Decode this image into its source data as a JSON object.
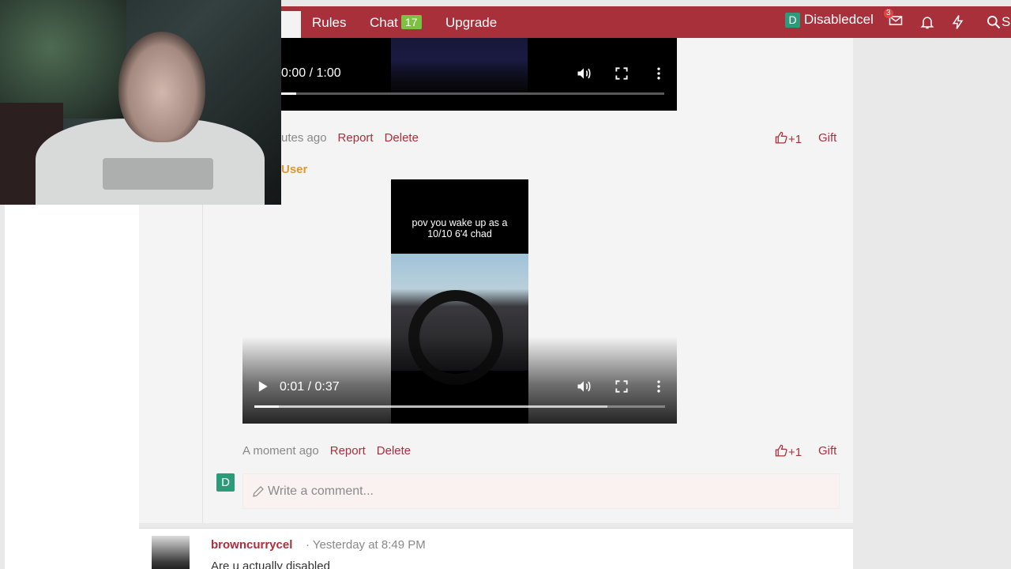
{
  "nav": {
    "active_tab_fragment": "s",
    "items": [
      "Rules",
      "Chat",
      "Upgrade"
    ],
    "chat_count": "17",
    "user_initial": "D",
    "username": "Disabledcel",
    "inbox_count": "3",
    "search_fragment": "S"
  },
  "video1": {
    "time": "0:00 / 1:00",
    "progress": 0.04
  },
  "comment1": {
    "time_fragment": "utes ago",
    "report": "Report",
    "delete": "Delete",
    "like": "+1",
    "gift": "Gift"
  },
  "comment2": {
    "author_fragment": "User",
    "video_caption_line1": "pov you wake up as a",
    "video_caption_line2": "10/10 6'4 chad",
    "video_time": "0:01 / 0:37",
    "video_progress": 0.06,
    "video_buffered": 0.86,
    "time": "A moment ago",
    "report": "Report",
    "delete": "Delete",
    "like": "+1",
    "gift": "Gift"
  },
  "composer": {
    "avatar_initial": "D",
    "placeholder": "Write a comment..."
  },
  "post": {
    "author": "browncurrycel",
    "meta": "· Yesterday at 8:49 PM",
    "text": "Are u actually disabled"
  },
  "colors": {
    "brand": "#a8303a",
    "chat_badge": "#7cc142",
    "avatar": "#2d9a7a"
  }
}
